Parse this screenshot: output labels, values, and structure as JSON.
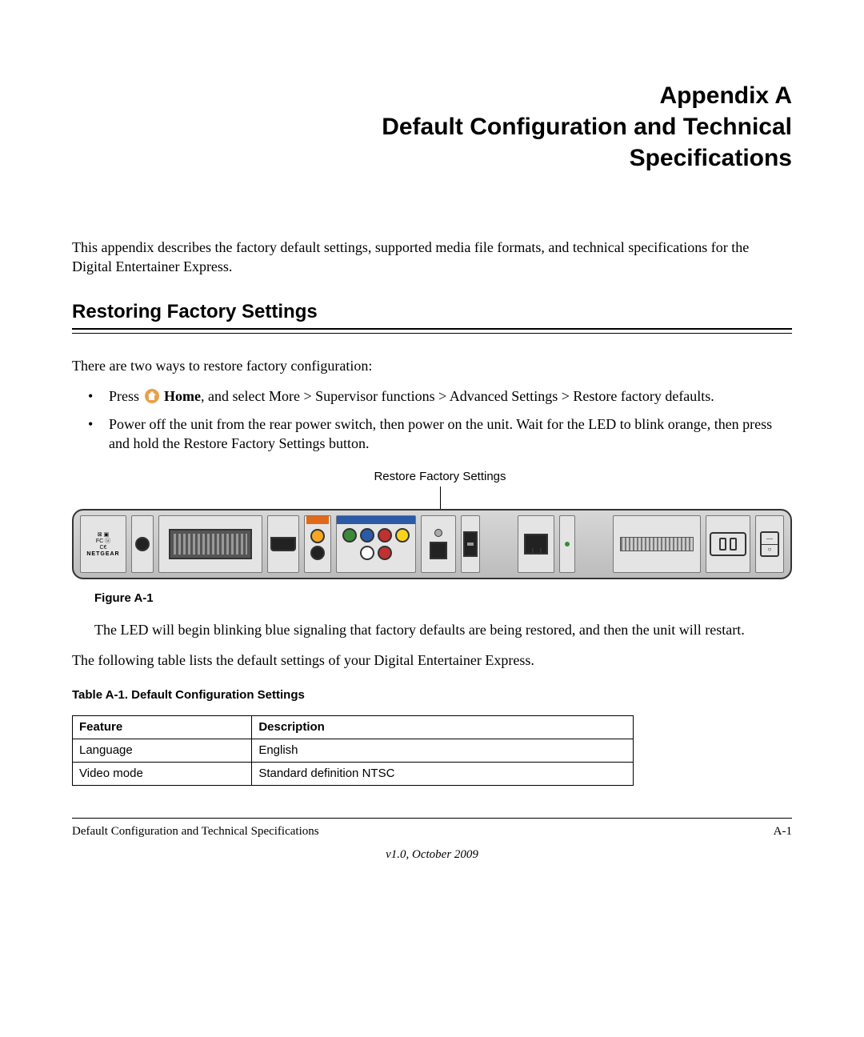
{
  "title": {
    "line1": "Appendix A",
    "line2": "Default Configuration and Technical",
    "line3": "Specifications"
  },
  "intro": "This appendix describes the factory default settings, supported media file formats, and technical specifications for the Digital Entertainer Express.",
  "section_heading": "Restoring Factory Settings",
  "restore_lead": "There are two ways to restore factory configuration:",
  "bullets": {
    "b1_press": "Press ",
    "b1_home_bold": "Home",
    "b1_rest": ", and select More > Supervisor functions > Advanced Settings > Restore factory defaults.",
    "b2": "Power off the unit from the rear power switch, then power on the unit. Wait for the LED to blink orange, then press and hold the Restore Factory Settings button."
  },
  "callout_label": "Restore Factory Settings",
  "figure_caption": "Figure A-1",
  "after_figure": "The LED will begin blinking blue signaling that factory defaults are being restored, and then the unit will restart.",
  "table_lead": "The following table lists the default settings of your Digital Entertainer Express.",
  "table_caption": "Table A-1.  Default Configuration Settings",
  "table": {
    "headers": {
      "feature": "Feature",
      "description": "Description"
    },
    "rows": [
      {
        "feature": "Language",
        "description": "English"
      },
      {
        "feature": "Video mode",
        "description": "Standard definition NTSC"
      }
    ]
  },
  "footer": {
    "left": "Default Configuration and Technical Specifications",
    "right": "A-1",
    "version": "v1.0, October 2009"
  },
  "device_brand": "NETGEAR"
}
